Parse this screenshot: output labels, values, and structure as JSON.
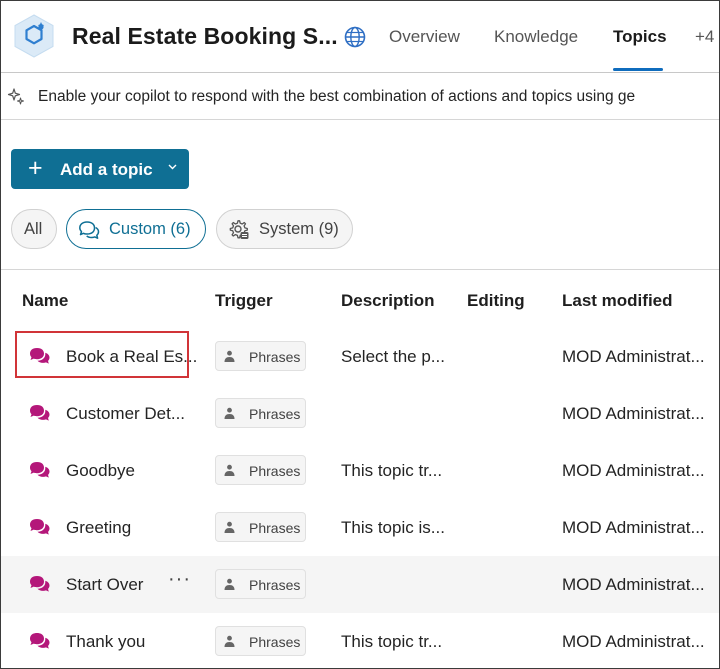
{
  "header": {
    "title": "Real Estate Booking S...",
    "tabs": [
      {
        "label": "Overview",
        "active": false
      },
      {
        "label": "Knowledge",
        "active": false
      },
      {
        "label": "Topics",
        "active": true
      },
      {
        "label": "+4",
        "active": false
      }
    ],
    "accent_color": "#0f6cbd"
  },
  "banner": {
    "text": "Enable your copilot to respond with the best combination of actions and topics using ge"
  },
  "toolbar": {
    "add_topic_label": "Add a topic",
    "button_color": "#0f6f94"
  },
  "filters": [
    {
      "label": "All",
      "active": false
    },
    {
      "label": "Custom (6)",
      "active": true
    },
    {
      "label": "System (9)",
      "active": false
    }
  ],
  "table": {
    "columns": [
      "Name",
      "Trigger",
      "Description",
      "Editing",
      "Last modified"
    ],
    "rows": [
      {
        "name": "Book a Real Es...",
        "trigger": "Phrases",
        "description": "Select the p...",
        "editing": "",
        "modified": "MOD Administrat..."
      },
      {
        "name": "Customer Det...",
        "trigger": "Phrases",
        "description": "",
        "editing": "",
        "modified": "MOD Administrat..."
      },
      {
        "name": "Goodbye",
        "trigger": "Phrases",
        "description": "This topic tr...",
        "editing": "",
        "modified": "MOD Administrat..."
      },
      {
        "name": "Greeting",
        "trigger": "Phrases",
        "description": "This topic is...",
        "editing": "",
        "modified": "MOD Administrat..."
      },
      {
        "name": "Start Over",
        "trigger": "Phrases",
        "description": "",
        "editing": "",
        "modified": "MOD Administrat...",
        "more": "···"
      },
      {
        "name": "Thank you",
        "trigger": "Phrases",
        "description": "This topic tr...",
        "editing": "",
        "modified": "MOD Administrat..."
      }
    ],
    "topic_icon_color": "#b4177a",
    "highlight_color": "#d13438"
  }
}
